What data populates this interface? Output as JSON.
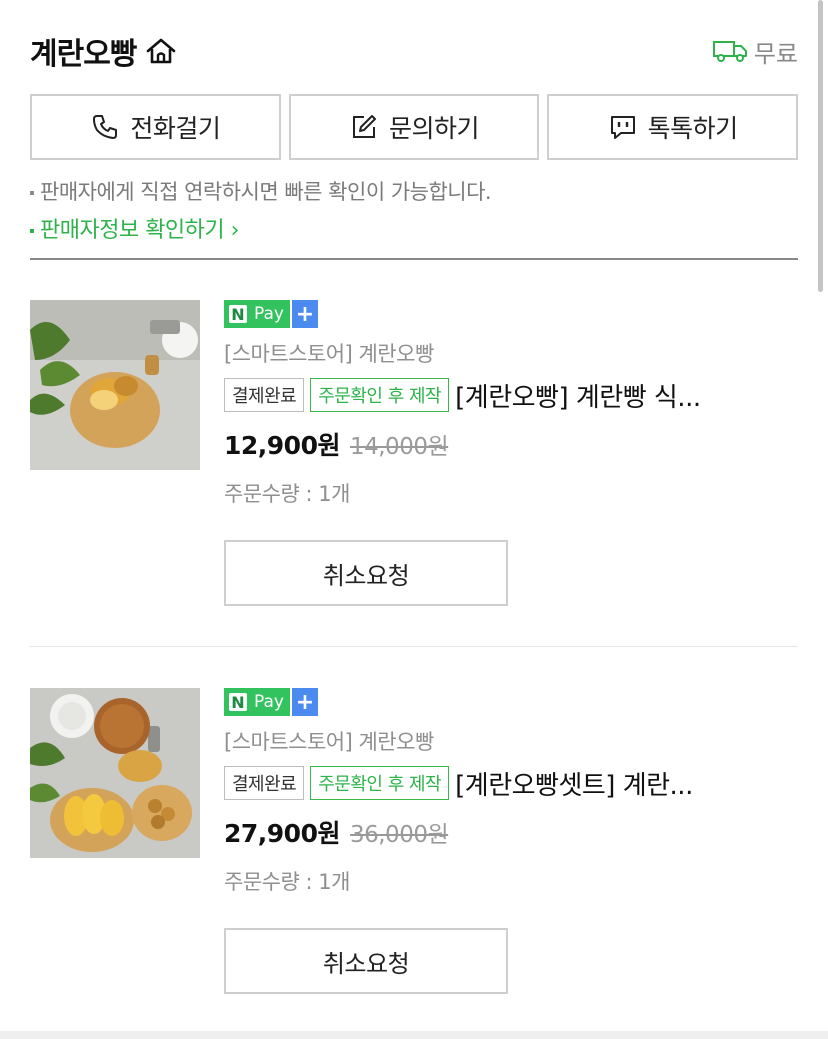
{
  "header": {
    "store_name": "계란오빵",
    "shipping_label": "무료"
  },
  "actions": {
    "call_label": "전화걸기",
    "inquiry_label": "문의하기",
    "talk_label": "톡톡하기"
  },
  "notice": {
    "text": "판매자에게 직접 연락하시면 빠른 확인이 가능합니다.",
    "seller_info_link": "판매자정보 확인하기"
  },
  "products": [
    {
      "npay_n": "N",
      "npay_pay": "Pay",
      "npay_plus": "+",
      "seller": "[스마트스토어] 계란오빵",
      "status_badge": "결제완료",
      "production_badge": "주문확인 후 제작",
      "title": "[계란오빵] 계란빵 식...",
      "price": "12,900원",
      "original_price": "14,000원",
      "quantity": "주문수량 : 1개",
      "cancel_label": "취소요청"
    },
    {
      "npay_n": "N",
      "npay_pay": "Pay",
      "npay_plus": "+",
      "seller": "[스마트스토어] 계란오빵",
      "status_badge": "결제완료",
      "production_badge": "주문확인 후 제작",
      "title": "[계란오빵셋트] 계란...",
      "price": "27,900원",
      "original_price": "36,000원",
      "quantity": "주문수량 : 1개",
      "cancel_label": "취소요청"
    }
  ],
  "colors": {
    "accent_green": "#2db34a",
    "npay_green": "#33c35e",
    "npay_blue": "#4b8bf0"
  },
  "icons": {
    "home": "home-icon",
    "truck": "truck-icon",
    "phone": "phone-icon",
    "edit": "edit-icon",
    "chat": "chat-icon"
  }
}
